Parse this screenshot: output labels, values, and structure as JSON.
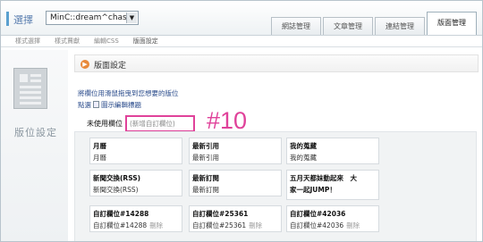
{
  "header": {
    "select_label": "選擇",
    "blog_name": "MinC::dream^chaser",
    "tabs": [
      "網誌管理",
      "文章管理",
      "連結管理",
      "版面管理"
    ]
  },
  "subnav": [
    "樣式選擇",
    "樣式賈獻",
    "編輯CSS",
    "版面設定"
  ],
  "left_title": "版位設定",
  "section": {
    "title": "版面設定",
    "hint": "將欄位用滑鼠拖曳到您想要的版位",
    "link_restore": "點選",
    "link_edit": "圖示編輯標題",
    "unused_label": "未使用欄位",
    "add_field": "(新增自訂欄位)",
    "callout": "#10"
  },
  "cards": [
    {
      "title": "月曆",
      "body": "月曆"
    },
    {
      "title": "最新引用",
      "body": "最新引用"
    },
    {
      "title": "我的蒐藏",
      "body": "我的蒐藏"
    },
    {
      "title": "新聞交換(RSS)",
      "body": "新聞交換(RSS)"
    },
    {
      "title": "最新訂閱",
      "body": "最新訂閱"
    },
    {
      "title": "五月天都妹動起來　大",
      "body": "家一起JUMP！"
    },
    {
      "title": "自訂欄位#14288",
      "body": "自訂欄位#14288",
      "remove": "刪除"
    },
    {
      "title": "自訂欄位#25361",
      "body": "自訂欄位#25361",
      "remove": "刪除"
    },
    {
      "title": "自訂欄位#42036",
      "body": "自訂欄位#42036",
      "remove": "刪除"
    }
  ]
}
